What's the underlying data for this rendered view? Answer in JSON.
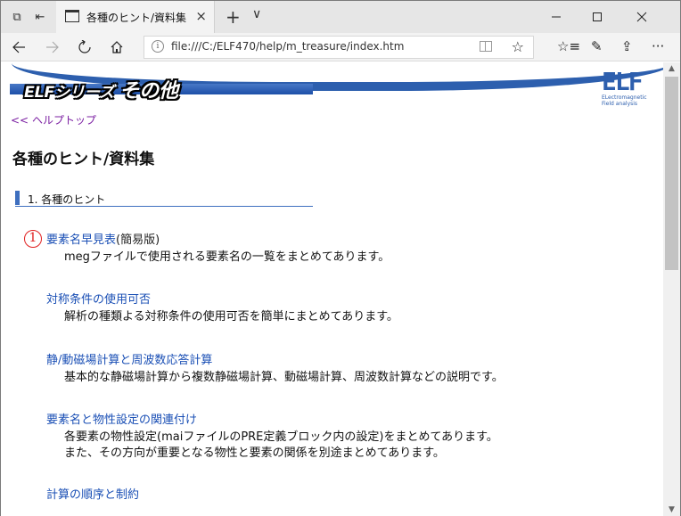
{
  "browser": {
    "tab_title": "各種のヒント/資料集",
    "tab_close": "×",
    "new_tab": "+",
    "tab_list": "∨",
    "address": "file:///C:/ELF470/help/m_treasure/index.htm",
    "icons": [
      "tabs-aside-icon",
      "tab-back-icon",
      "page-icon",
      "back-icon",
      "forward-icon",
      "refresh-icon",
      "home-icon",
      "info-icon",
      "reading-view-icon",
      "favorite-icon",
      "favorites-hub-icon",
      "pen-icon",
      "share-icon",
      "more-icon"
    ],
    "more": "···"
  },
  "page": {
    "banner_series": "ELFシリーズ",
    "banner_other": "その他",
    "logo_mark": "ELF",
    "logo_sub1": "ELectromagnetic",
    "logo_sub2": "Field analysis",
    "home_link": "ヘルプトップ",
    "home_link_prefix": "<<",
    "title": "各種のヒント/資料集",
    "section_label": "1. 各種のヒント",
    "marker": "①",
    "items": [
      {
        "link": "要素名早見表",
        "suffix": "(簡易版)",
        "desc": [
          "megファイルで使用される要素名の一覧をまとめてあります。"
        ]
      },
      {
        "link": "対称条件の使用可否",
        "suffix": "",
        "desc": [
          "解析の種類よる対称条件の使用可否を簡単にまとめてあります。"
        ]
      },
      {
        "link": "静/動磁場計算と周波数応答計算",
        "suffix": "",
        "desc": [
          "基本的な静磁場計算から複数静磁場計算、動磁場計算、周波数計算などの説明です。"
        ]
      },
      {
        "link": "要素名と物性設定の関連付け",
        "suffix": "",
        "desc": [
          "各要素の物性設定(maiファイルのPRE定義ブロック内の設定)をまとめてあります。",
          "また、その方向が重要となる物性と要素の関係を別途まとめてあります。"
        ]
      },
      {
        "link": "計算の順序と制約",
        "suffix": "",
        "desc": []
      }
    ]
  },
  "colors": {
    "link": "#1a4fb5",
    "visited": "#7b1fa2",
    "accent": "#3e6fbf",
    "marker": "#e02020"
  }
}
